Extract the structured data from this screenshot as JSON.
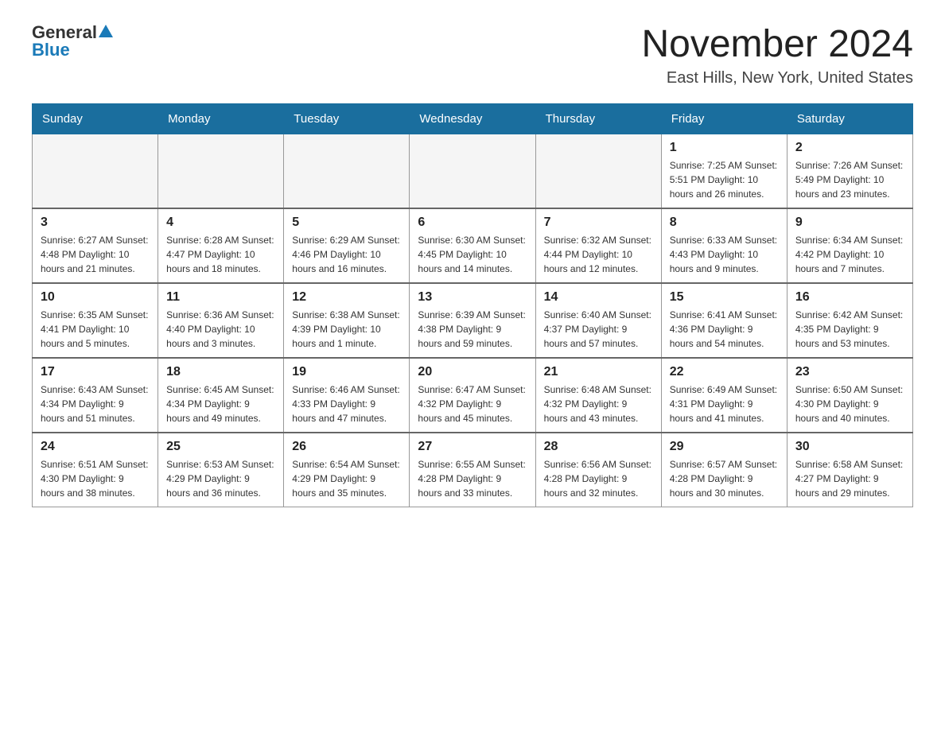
{
  "logo": {
    "general": "General",
    "blue": "Blue"
  },
  "title": "November 2024",
  "subtitle": "East Hills, New York, United States",
  "weekdays": [
    "Sunday",
    "Monday",
    "Tuesday",
    "Wednesday",
    "Thursday",
    "Friday",
    "Saturday"
  ],
  "weeks": [
    [
      {
        "day": "",
        "info": ""
      },
      {
        "day": "",
        "info": ""
      },
      {
        "day": "",
        "info": ""
      },
      {
        "day": "",
        "info": ""
      },
      {
        "day": "",
        "info": ""
      },
      {
        "day": "1",
        "info": "Sunrise: 7:25 AM\nSunset: 5:51 PM\nDaylight: 10 hours\nand 26 minutes."
      },
      {
        "day": "2",
        "info": "Sunrise: 7:26 AM\nSunset: 5:49 PM\nDaylight: 10 hours\nand 23 minutes."
      }
    ],
    [
      {
        "day": "3",
        "info": "Sunrise: 6:27 AM\nSunset: 4:48 PM\nDaylight: 10 hours\nand 21 minutes."
      },
      {
        "day": "4",
        "info": "Sunrise: 6:28 AM\nSunset: 4:47 PM\nDaylight: 10 hours\nand 18 minutes."
      },
      {
        "day": "5",
        "info": "Sunrise: 6:29 AM\nSunset: 4:46 PM\nDaylight: 10 hours\nand 16 minutes."
      },
      {
        "day": "6",
        "info": "Sunrise: 6:30 AM\nSunset: 4:45 PM\nDaylight: 10 hours\nand 14 minutes."
      },
      {
        "day": "7",
        "info": "Sunrise: 6:32 AM\nSunset: 4:44 PM\nDaylight: 10 hours\nand 12 minutes."
      },
      {
        "day": "8",
        "info": "Sunrise: 6:33 AM\nSunset: 4:43 PM\nDaylight: 10 hours\nand 9 minutes."
      },
      {
        "day": "9",
        "info": "Sunrise: 6:34 AM\nSunset: 4:42 PM\nDaylight: 10 hours\nand 7 minutes."
      }
    ],
    [
      {
        "day": "10",
        "info": "Sunrise: 6:35 AM\nSunset: 4:41 PM\nDaylight: 10 hours\nand 5 minutes."
      },
      {
        "day": "11",
        "info": "Sunrise: 6:36 AM\nSunset: 4:40 PM\nDaylight: 10 hours\nand 3 minutes."
      },
      {
        "day": "12",
        "info": "Sunrise: 6:38 AM\nSunset: 4:39 PM\nDaylight: 10 hours\nand 1 minute."
      },
      {
        "day": "13",
        "info": "Sunrise: 6:39 AM\nSunset: 4:38 PM\nDaylight: 9 hours\nand 59 minutes."
      },
      {
        "day": "14",
        "info": "Sunrise: 6:40 AM\nSunset: 4:37 PM\nDaylight: 9 hours\nand 57 minutes."
      },
      {
        "day": "15",
        "info": "Sunrise: 6:41 AM\nSunset: 4:36 PM\nDaylight: 9 hours\nand 54 minutes."
      },
      {
        "day": "16",
        "info": "Sunrise: 6:42 AM\nSunset: 4:35 PM\nDaylight: 9 hours\nand 53 minutes."
      }
    ],
    [
      {
        "day": "17",
        "info": "Sunrise: 6:43 AM\nSunset: 4:34 PM\nDaylight: 9 hours\nand 51 minutes."
      },
      {
        "day": "18",
        "info": "Sunrise: 6:45 AM\nSunset: 4:34 PM\nDaylight: 9 hours\nand 49 minutes."
      },
      {
        "day": "19",
        "info": "Sunrise: 6:46 AM\nSunset: 4:33 PM\nDaylight: 9 hours\nand 47 minutes."
      },
      {
        "day": "20",
        "info": "Sunrise: 6:47 AM\nSunset: 4:32 PM\nDaylight: 9 hours\nand 45 minutes."
      },
      {
        "day": "21",
        "info": "Sunrise: 6:48 AM\nSunset: 4:32 PM\nDaylight: 9 hours\nand 43 minutes."
      },
      {
        "day": "22",
        "info": "Sunrise: 6:49 AM\nSunset: 4:31 PM\nDaylight: 9 hours\nand 41 minutes."
      },
      {
        "day": "23",
        "info": "Sunrise: 6:50 AM\nSunset: 4:30 PM\nDaylight: 9 hours\nand 40 minutes."
      }
    ],
    [
      {
        "day": "24",
        "info": "Sunrise: 6:51 AM\nSunset: 4:30 PM\nDaylight: 9 hours\nand 38 minutes."
      },
      {
        "day": "25",
        "info": "Sunrise: 6:53 AM\nSunset: 4:29 PM\nDaylight: 9 hours\nand 36 minutes."
      },
      {
        "day": "26",
        "info": "Sunrise: 6:54 AM\nSunset: 4:29 PM\nDaylight: 9 hours\nand 35 minutes."
      },
      {
        "day": "27",
        "info": "Sunrise: 6:55 AM\nSunset: 4:28 PM\nDaylight: 9 hours\nand 33 minutes."
      },
      {
        "day": "28",
        "info": "Sunrise: 6:56 AM\nSunset: 4:28 PM\nDaylight: 9 hours\nand 32 minutes."
      },
      {
        "day": "29",
        "info": "Sunrise: 6:57 AM\nSunset: 4:28 PM\nDaylight: 9 hours\nand 30 minutes."
      },
      {
        "day": "30",
        "info": "Sunrise: 6:58 AM\nSunset: 4:27 PM\nDaylight: 9 hours\nand 29 minutes."
      }
    ]
  ]
}
